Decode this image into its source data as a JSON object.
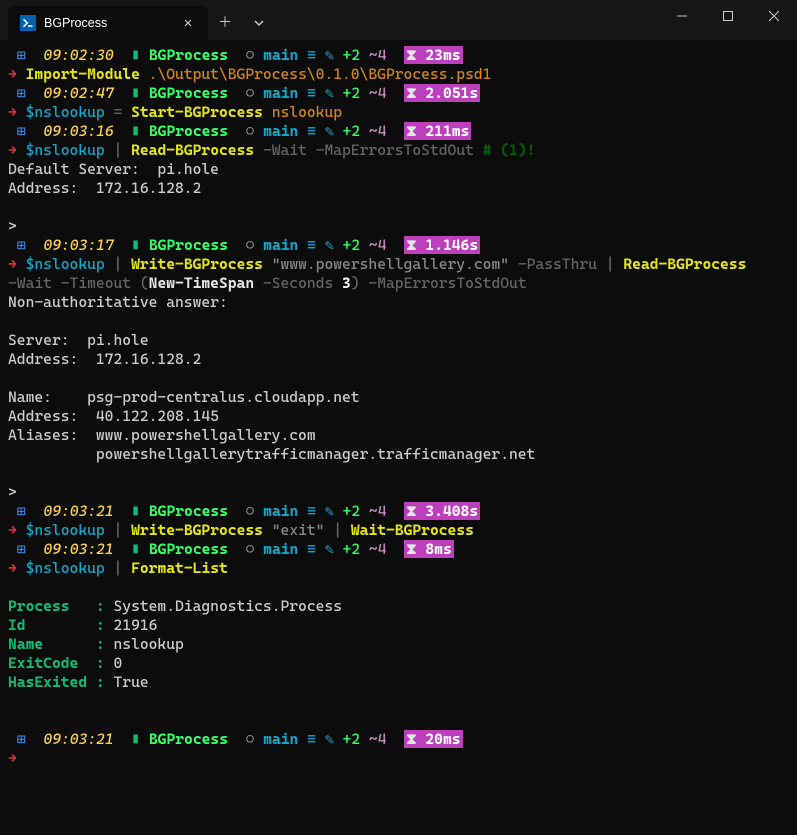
{
  "window": {
    "tab_title": "BGProcess"
  },
  "blocks": [
    {
      "prompt": {
        "time": "09:02:30",
        "folder": "BGProcess",
        "branch": "main",
        "staged": "+2",
        "modified": "~4",
        "duration": "23ms"
      },
      "cmd_html": "<span class='cmd-yellow'>Import-Module</span> <span class='cmd-text'>.\\Output\\BGProcess\\0.1.0\\BGProcess.psd1</span>",
      "output": []
    },
    {
      "prompt": {
        "time": "09:02:47",
        "folder": "BGProcess",
        "branch": "main",
        "staged": "+2",
        "modified": "~4",
        "duration": "2.051s"
      },
      "cmd_html": "<span class='cmd-var'>$nslookup</span> <span class='cmd-pipe'>=</span> <span class='cmd-yellow'>Start-BGProcess</span> <span class='cmd-text'>nslookup</span>",
      "output": []
    },
    {
      "prompt": {
        "time": "09:03:16",
        "folder": "BGProcess",
        "branch": "main",
        "staged": "+2",
        "modified": "~4",
        "duration": "211ms"
      },
      "cmd_html": "<span class='cmd-var'>$nslookup</span> <span class='cmd-pipe'>|</span> <span class='cmd-yellow'>Read-BGProcess</span> <span class='cmd-param'>-Wait</span> <span class='cmd-param'>-MapErrorsToStdOut</span> <span class='cmd-comment'># (1)!</span>",
      "output": [
        "Default Server:  pi.hole",
        "Address:  172.16.128.2",
        "",
        ">"
      ]
    },
    {
      "prompt": {
        "time": "09:03:17",
        "folder": "BGProcess",
        "branch": "main",
        "staged": "+2",
        "modified": "~4",
        "duration": "1.146s"
      },
      "cmd_html": "<span class='cmd-var'>$nslookup</span> <span class='cmd-pipe'>|</span> <span class='cmd-yellow'>Write-BGProcess</span> <span class='cmd-stringq'>\"www.powershellgallery.com\"</span> <span class='cmd-param'>-PassThru</span> <span class='cmd-pipe'>|</span> <span class='cmd-yellow'>Read-BGProcess</span>",
      "cmd_html2": "<span class='cmd-param'>-Wait</span> <span class='cmd-param'>-Timeout</span> <span class='cmd-pipe'>(</span><span class='cmd-bright'>New-TimeSpan</span> <span class='cmd-param'>-Seconds</span> <span class='cmd-num'>3</span><span class='cmd-pipe'>)</span> <span class='cmd-param'>-MapErrorsToStdOut</span>",
      "output": [
        "Non-authoritative answer:",
        "",
        "Server:  pi.hole",
        "Address:  172.16.128.2",
        "",
        "Name:    psg-prod-centralus.cloudapp.net",
        "Address:  40.122.208.145",
        "Aliases:  www.powershellgallery.com",
        "          powershellgallerytrafficmanager.trafficmanager.net",
        "",
        ">"
      ]
    },
    {
      "prompt": {
        "time": "09:03:21",
        "folder": "BGProcess",
        "branch": "main",
        "staged": "+2",
        "modified": "~4",
        "duration": "3.408s"
      },
      "cmd_html": "<span class='cmd-var'>$nslookup</span> <span class='cmd-pipe'>|</span> <span class='cmd-yellow'>Write-BGProcess</span> <span class='cmd-stringq'>\"exit\"</span> <span class='cmd-pipe'>|</span> <span class='cmd-yellow'>Wait-BGProcess</span>",
      "output": []
    },
    {
      "prompt": {
        "time": "09:03:21",
        "folder": "BGProcess",
        "branch": "main",
        "staged": "+2",
        "modified": "~4",
        "duration": "8ms"
      },
      "cmd_html": "<span class='cmd-var'>$nslookup</span> <span class='cmd-pipe'>|</span> <span class='cmd-yellow'>Format-List</span>",
      "output": [],
      "format_list": [
        {
          "k": "Process  ",
          "v": "System.Diagnostics.Process"
        },
        {
          "k": "Id       ",
          "v": "21916"
        },
        {
          "k": "Name     ",
          "v": "nslookup"
        },
        {
          "k": "ExitCode ",
          "v": "0"
        },
        {
          "k": "HasExited",
          "v": "True"
        }
      ]
    },
    {
      "prompt": {
        "time": "09:03:21",
        "folder": "BGProcess",
        "branch": "main",
        "staged": "+2",
        "modified": "~4",
        "duration": "20ms"
      },
      "cmd_html": "",
      "output": []
    }
  ]
}
